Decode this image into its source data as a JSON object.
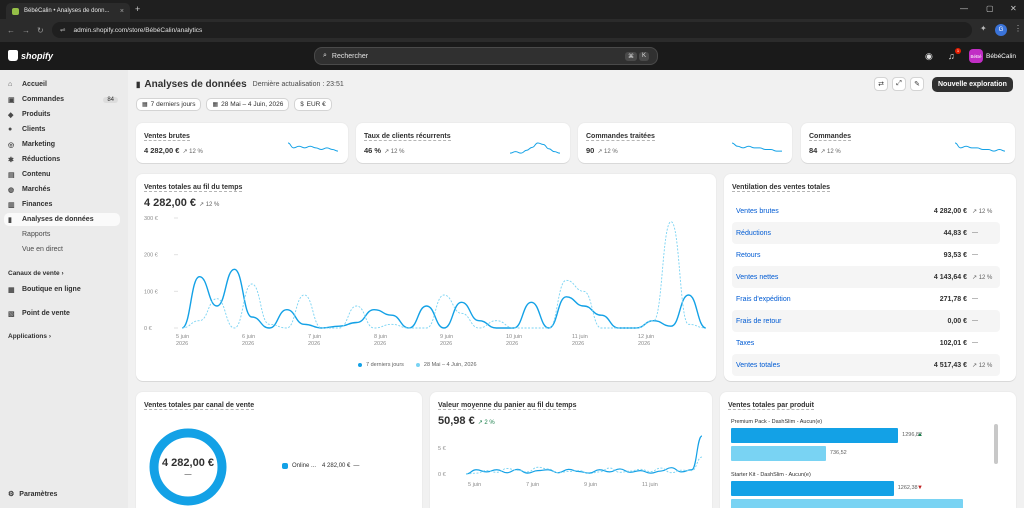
{
  "browser": {
    "tab_title": "BébéCalin • Analyses de donn...",
    "url": "admin.shopify.com/store/BébéCalin/analytics",
    "profile_initial": "G"
  },
  "topbar": {
    "logo_text": "shopify",
    "search_placeholder": "Rechercher",
    "shortcut_keys": [
      "⌘",
      "K"
    ],
    "notification_count": "1",
    "store_initials": "BéBé",
    "store_name": "BébéCalin"
  },
  "sidebar": {
    "items": [
      {
        "label": "Accueil",
        "icon": "home-icon",
        "glyph": "⌂"
      },
      {
        "label": "Commandes",
        "icon": "inbox-icon",
        "glyph": "▣",
        "badge": "84"
      },
      {
        "label": "Produits",
        "icon": "tag-icon",
        "glyph": "◆"
      },
      {
        "label": "Clients",
        "icon": "person-icon",
        "glyph": "●"
      },
      {
        "label": "Marketing",
        "icon": "target-icon",
        "glyph": "◎"
      },
      {
        "label": "Réductions",
        "icon": "discount-icon",
        "glyph": "✱"
      },
      {
        "label": "Contenu",
        "icon": "content-icon",
        "glyph": "▤"
      },
      {
        "label": "Marchés",
        "icon": "globe-icon",
        "glyph": "◍"
      },
      {
        "label": "Finances",
        "icon": "bank-icon",
        "glyph": "▥"
      },
      {
        "label": "Analyses de données",
        "icon": "chart-icon",
        "glyph": "▮"
      }
    ],
    "subitems": [
      "Rapports",
      "Vue en direct"
    ],
    "sales_channels": "Canaux de vente",
    "online_store": "Boutique en ligne",
    "pos": "Point de vente",
    "applications": "Applications",
    "settings": "Paramètres"
  },
  "page": {
    "title": "Analyses de données",
    "last_update": "Dernière actualisation : 23:51",
    "primary_action": "Nouvelle exploration",
    "filters": [
      "7 derniers jours",
      "28 Mai – 4 Juin, 2026",
      "EUR €"
    ]
  },
  "metrics": [
    {
      "label": "Ventes brutes",
      "value": "4 282,00 €",
      "delta": "↗ 12 %",
      "spark": [
        8,
        5,
        6,
        5,
        6,
        5,
        4,
        5,
        4,
        3
      ]
    },
    {
      "label": "Taux de clients récurrents",
      "value": "46 %",
      "delta": "↗ 12 %",
      "spark": [
        2,
        3,
        2,
        4,
        6,
        9,
        8,
        5,
        3,
        2
      ]
    },
    {
      "label": "Commandes traitées",
      "value": "90",
      "delta": "↗ 12 %",
      "spark": [
        8,
        6,
        5,
        6,
        5,
        5,
        4,
        4,
        3,
        3
      ]
    },
    {
      "label": "Commandes",
      "value": "84",
      "delta": "↗ 12 %",
      "spark": [
        8,
        5,
        6,
        5,
        5,
        4,
        4,
        3,
        4,
        3
      ]
    }
  ],
  "sales_over_time": {
    "title": "Ventes totales au fil du temps",
    "value": "4 282,00 €",
    "delta": "↗ 12 %",
    "legend": [
      "7 derniers jours",
      "28 Mai – 4 Juin, 2026"
    ]
  },
  "chart_data": [
    {
      "type": "line",
      "title": "Ventes totales au fil du temps",
      "y_ticks": [
        "300 €",
        "200 €",
        "100 €",
        "0 €"
      ],
      "ylim": [
        0,
        300
      ],
      "x_ticks": [
        "5 juin\n2026",
        "6 juin\n2026",
        "7 juin\n2026",
        "8 juin\n2026",
        "9 juin\n2026",
        "10 juin\n2026",
        "11 juin\n2026",
        "12 juin\n2026"
      ],
      "series": [
        {
          "name": "7 derniers jours",
          "style": "solid",
          "color": "#13a1e6",
          "values": [
            0,
            140,
            60,
            160,
            30,
            0,
            50,
            10,
            0,
            5,
            15,
            50,
            35,
            0,
            60,
            0,
            70,
            20,
            0,
            0,
            70,
            0,
            85,
            60,
            35,
            0,
            0,
            20,
            5,
            90,
            0
          ]
        },
        {
          "name": "28 Mai – 4 Juin, 2026",
          "style": "dashed",
          "color": "#79d3f3",
          "values": [
            0,
            20,
            80,
            0,
            120,
            10,
            0,
            90,
            0,
            0,
            60,
            0,
            10,
            0,
            0,
            90,
            40,
            0,
            20,
            0,
            0,
            0,
            130,
            100,
            0,
            0,
            0,
            20,
            290,
            10,
            0
          ]
        }
      ]
    },
    {
      "type": "pie",
      "title": "Ventes totales par canal de vente",
      "categories": [
        "Online ..."
      ],
      "values": [
        4282.0
      ],
      "center_value": "4 282,00 €",
      "center_sub": "—",
      "legend_value": "4 282,00 €",
      "legend_delta": "—"
    },
    {
      "type": "line",
      "title": "Valeur moyenne du panier au fil du temps",
      "value": "50,98 €",
      "delta": "↗ 2 %",
      "y_ticks": [
        "5 €",
        "0 €"
      ],
      "x_ticks": [
        "5 juin",
        "7 juin",
        "9 juin",
        "11 juin"
      ],
      "series": [
        {
          "name": "7 derniers jours",
          "style": "solid",
          "values": [
            0,
            1,
            0.5,
            1,
            0.3,
            1.1,
            0.2,
            0.8,
            1,
            0.3,
            1.1,
            0.6,
            0.2,
            1,
            0.5,
            1.2,
            0.4,
            0.8,
            0.2,
            0.7,
            1.5,
            0.5,
            1,
            9
          ]
        },
        {
          "name": "28 Mai – 4 Juin, 2026",
          "style": "dashed",
          "values": [
            0,
            0.2,
            0.8,
            0.4,
            1.3,
            0.9,
            0.5,
            1.6,
            1.2,
            0.3,
            0.6,
            0.8,
            0.1,
            0.5,
            1.4,
            0.4,
            0.7,
            1.1,
            0.6,
            1.4,
            0.3,
            0.9,
            0.8,
            4
          ]
        }
      ]
    },
    {
      "type": "bar",
      "title": "Ventes totales par produit",
      "categories": [
        "Premium Pack - DashSlim - Aucun(e)",
        "Starter Kit - DashSlim - Aucun(e)"
      ],
      "series": [
        {
          "name": "7 derniers jours",
          "values": [
            1296.82,
            1262.38
          ]
        },
        {
          "name": "28 Mai – 4 Juin, 2026",
          "values": [
            736.52,
            1800
          ]
        }
      ],
      "value_labels": [
        "1296,82",
        "736,52",
        "1262,38"
      ],
      "trends": [
        "up",
        "down"
      ]
    }
  ],
  "breakdown": {
    "title": "Ventilation des ventes totales",
    "rows": [
      {
        "label": "Ventes brutes",
        "value": "4 282,00 €",
        "delta": "↗ 12 %"
      },
      {
        "label": "Réductions",
        "value": "44,83 €",
        "delta": "—"
      },
      {
        "label": "Retours",
        "value": "93,53 €",
        "delta": "—"
      },
      {
        "label": "Ventes nettes",
        "value": "4 143,64 €",
        "delta": "↗ 12 %"
      },
      {
        "label": "Frais d'expédition",
        "value": "271,78 €",
        "delta": "—"
      },
      {
        "label": "Frais de retour",
        "value": "0,00 €",
        "delta": "—"
      },
      {
        "label": "Taxes",
        "value": "102,01 €",
        "delta": "—"
      },
      {
        "label": "Ventes totales",
        "value": "4 517,43 €",
        "delta": "↗ 12 %"
      }
    ]
  },
  "colors": {
    "primary": "#13a1e6",
    "secondary": "#79d3f3",
    "link": "#005bd3"
  }
}
